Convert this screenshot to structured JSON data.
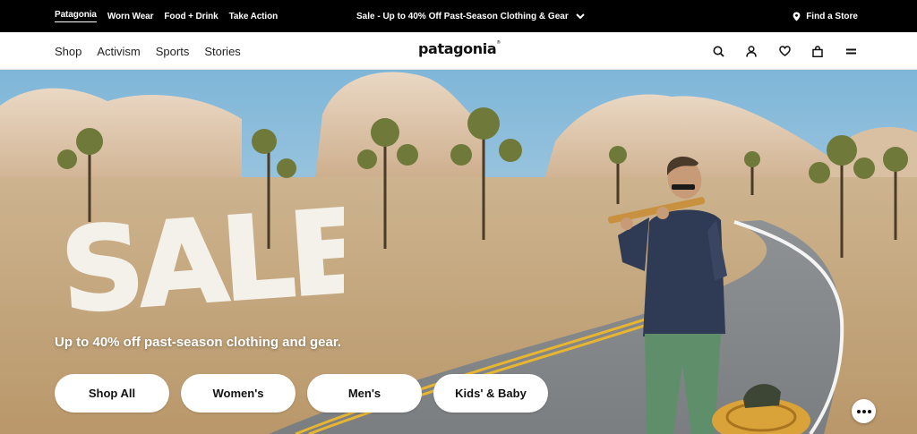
{
  "topbar": {
    "links": [
      "Patagonia",
      "Worn Wear",
      "Food + Drink",
      "Take Action"
    ],
    "promo": "Sale - Up to 40% Off Past-Season Clothing & Gear",
    "store_label": "Find a Store",
    "store_icon": "location-pin-icon",
    "promo_icon": "chevron-down-icon"
  },
  "nav": {
    "menu": [
      "Shop",
      "Activism",
      "Sports",
      "Stories"
    ],
    "logo": "patagonia",
    "logo_mark": "®",
    "icons": [
      "search-icon",
      "account-icon",
      "wishlist-heart-icon",
      "cart-bag-icon",
      "menu-icon"
    ]
  },
  "hero": {
    "headline": "SALE",
    "subtitle": "Up to 40% off past-season clothing and gear.",
    "buttons": [
      "Shop All",
      "Women's",
      "Men's",
      "Kids' & Baby"
    ]
  },
  "colors": {
    "topbar_bg": "#000000",
    "button_bg": "#ffffff",
    "road_line": "#e8b531"
  }
}
